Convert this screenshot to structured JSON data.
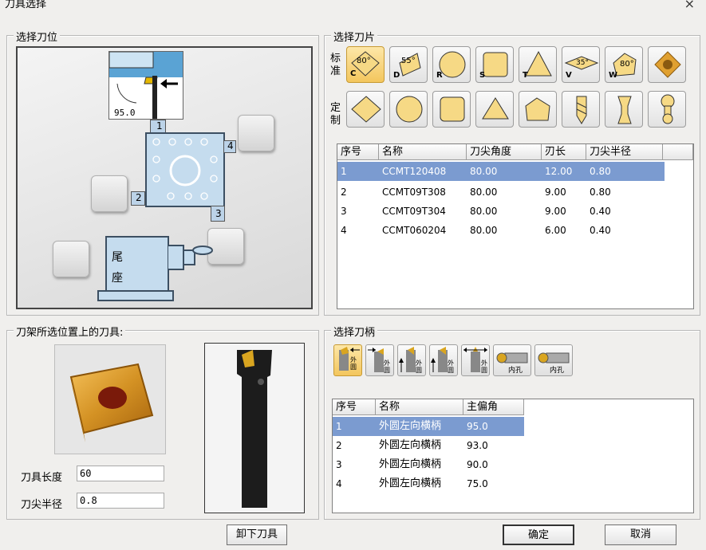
{
  "window": {
    "title": "刀具选择",
    "close_glyph": "×"
  },
  "left_top": {
    "label": "选择刀位",
    "diagram": {
      "tool_angle": "95.0",
      "positions": [
        "1",
        "2",
        "3",
        "4"
      ],
      "tailstock": [
        "尾",
        "座"
      ]
    }
  },
  "right_top": {
    "label": "选择刀片",
    "standard_label": [
      "标",
      "准"
    ],
    "custom_label": [
      "定",
      "制"
    ],
    "standard_buttons": [
      {
        "letter": "C",
        "angle": "80°",
        "icon": "rhombus-80-icon"
      },
      {
        "letter": "D",
        "angle": "55°",
        "icon": "rhombus-55-icon"
      },
      {
        "letter": "R",
        "angle": "",
        "icon": "round-insert-icon"
      },
      {
        "letter": "S",
        "angle": "",
        "icon": "square-insert-icon"
      },
      {
        "letter": "T",
        "angle": "",
        "icon": "triangle-insert-icon"
      },
      {
        "letter": "V",
        "angle": "35°",
        "icon": "rhombus-35-icon"
      },
      {
        "letter": "W",
        "angle": "80°",
        "icon": "trigon-80-icon"
      },
      {
        "letter": "",
        "angle": "",
        "icon": "thread-insert-icon"
      }
    ],
    "custom_buttons": [
      "custom-rhombus-icon",
      "custom-round-icon",
      "custom-square-icon",
      "custom-triangle-icon",
      "custom-pentagon-icon",
      "drill-icon",
      "grooving-bar-icon",
      "boring-bar-icon"
    ],
    "table": {
      "columns": [
        "序号",
        "名称",
        "刀尖角度",
        "刃长",
        "刀尖半径"
      ],
      "rows": [
        [
          "1",
          "CCMT120408",
          "80.00",
          "12.00",
          "0.80"
        ],
        [
          "2",
          "CCMT09T308",
          "80.00",
          "9.00",
          "0.80"
        ],
        [
          "3",
          "CCMT09T304",
          "80.00",
          "9.00",
          "0.40"
        ],
        [
          "4",
          "CCMT060204",
          "80.00",
          "6.00",
          "0.40"
        ]
      ],
      "selected_row": 0
    }
  },
  "left_bottom": {
    "label": "刀架所选位置上的刀具:",
    "tool_length_label": "刀具长度",
    "tool_length_value": "60",
    "nose_radius_label": "刀尖半径",
    "nose_radius_value": "0.8",
    "unload_button": "卸下刀具"
  },
  "right_bottom": {
    "label": "选择刀柄",
    "holder_buttons": [
      {
        "sub": "外圆",
        "icon": "holder-left-turning-icon"
      },
      {
        "sub": "外圆",
        "icon": "holder-right-turning-icon"
      },
      {
        "sub": "外圆",
        "icon": "holder-up-left-icon"
      },
      {
        "sub": "外圆",
        "icon": "holder-up-right-icon"
      },
      {
        "sub": "外圆",
        "icon": "holder-neutral-icon"
      },
      {
        "sub": "内孔",
        "icon": "boring-bar-left-icon"
      },
      {
        "sub": "内孔",
        "icon": "boring-bar-right-icon"
      }
    ],
    "table": {
      "columns": [
        "序号",
        "名称",
        "主偏角"
      ],
      "rows": [
        [
          "1",
          "外圆左向横柄",
          "95.0"
        ],
        [
          "2",
          "外圆左向横柄",
          "93.0"
        ],
        [
          "3",
          "外圆左向横柄",
          "90.0"
        ],
        [
          "4",
          "外圆左向横柄",
          "75.0"
        ]
      ],
      "selected_row": 0
    }
  },
  "footer": {
    "ok": "确定",
    "cancel": "取消"
  }
}
